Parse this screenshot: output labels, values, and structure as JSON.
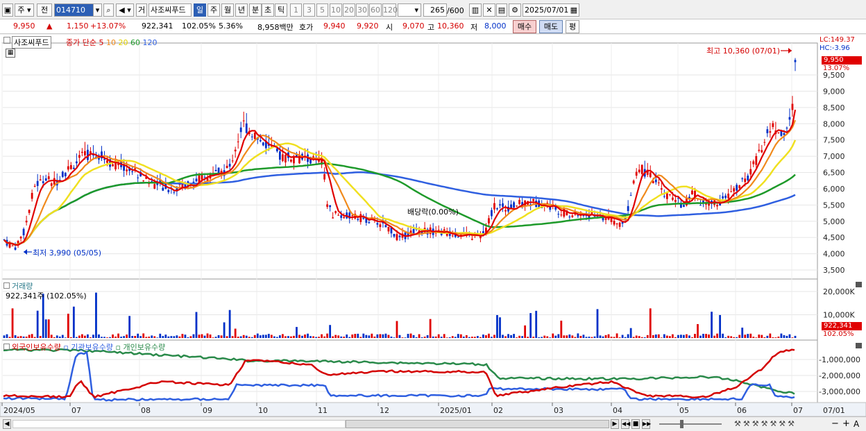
{
  "toolbar": {
    "period_options": [
      "주",
      "전"
    ],
    "stock_code": "014710",
    "broker_label": "거",
    "stock_name": "사조씨푸드",
    "timeframes": [
      "일",
      "주",
      "월",
      "년",
      "분",
      "초",
      "틱"
    ],
    "selected_timeframe": "일",
    "intervals": [
      "1",
      "3",
      "5",
      "10",
      "20",
      "30",
      "60",
      "120"
    ],
    "count": "265",
    "count_total": "/600",
    "date": "2025/07/01"
  },
  "quote": {
    "price": "9,950",
    "up_mark": "▲",
    "change": "1,150",
    "change_pct": "+13.07%",
    "volume": "922,341",
    "volume_pct": "102.05%",
    "turnover_pct": "5.36%",
    "trade_value": "8,958백만",
    "hoga_label": "호가",
    "ask": "9,940",
    "bid": "9,920",
    "open_label": "시",
    "open": "9,070",
    "high_label": "고",
    "high": "10,360",
    "low_label": "저",
    "low": "8,000",
    "buy_label": "매수",
    "sell_label": "매도",
    "eval_label": "평"
  },
  "price_panel": {
    "stock_tag": "사조씨푸드",
    "ma_title": "종가 단순",
    "ma_periods": [
      "5",
      "10",
      "20",
      "60",
      "120"
    ],
    "lc": "LC:149.37",
    "hc": "HC:-3.96",
    "high_note": "최고 10,360 (07/01)",
    "low_note": "최저 3,990 (05/05)",
    "dividend_note": "배당락(0.00%)",
    "last_price_tag": "9,950",
    "last_pct_tag": "13.07%",
    "y_ticks": [
      "9,500",
      "9,000",
      "8,500",
      "8,000",
      "7,500",
      "7,000",
      "6,500",
      "6,000",
      "5,500",
      "5,000",
      "4,500",
      "4,000",
      "3,500"
    ]
  },
  "volume_panel": {
    "title": "거래량",
    "summary": "922,341주 (102.05%)",
    "y_ticks": [
      "20,000K",
      "10,000K"
    ],
    "last_tag": "922,341",
    "last_pct_tag": "102.05%"
  },
  "holding_panel": {
    "legend": [
      "외국인보유수량",
      "기관보유수량",
      "개인보유수량"
    ],
    "y_ticks": [
      "-1,000,000",
      "-2,000,000",
      "-3,000,000"
    ]
  },
  "x_axis": [
    "2024/05",
    "07",
    "08",
    "09",
    "10",
    "11",
    "12",
    "2025/01",
    "02",
    "03",
    "04",
    "05",
    "06",
    "07",
    "07/01"
  ],
  "colors": {
    "ma5": "#e00000",
    "ma10": "#f08a1c",
    "ma20": "#f0e020",
    "ma60": "#1e9a2a",
    "ma120": "#2f5fe0",
    "up": "#e00000",
    "down": "#0030c8",
    "foreign": "#d40000",
    "institution": "#2f5fe0",
    "individual": "#2a8a4a"
  }
}
